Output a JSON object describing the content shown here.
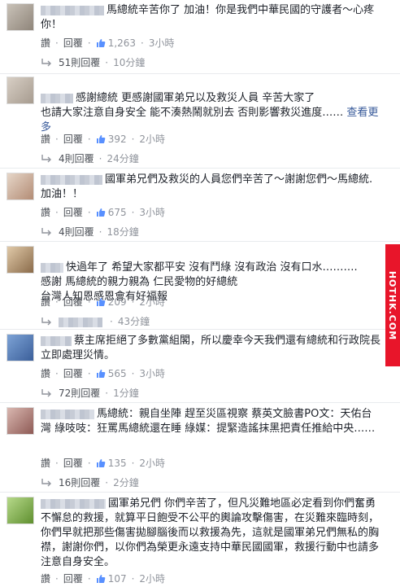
{
  "labels": {
    "like": "讚",
    "reply": "回覆"
  },
  "watermark": "HOTHK.COM",
  "comments": [
    {
      "text": "馬總統辛苦你了 加油！你是我們中華民國的守護者～心疼你！",
      "see_more": "",
      "likes": "1,263",
      "time": "3小時",
      "reply_count": "51則回覆",
      "reply_time": "10分鐘"
    },
    {
      "text": "感謝總統 更感謝國軍弟兄以及救災人員 辛苦大家了\n也請大家注意自身安全 能不湊熱鬧就別去 否則影響救災進度……",
      "see_more": "查看更多",
      "likes": "392",
      "time": "2小時",
      "reply_count": "4則回覆",
      "reply_time": "24分鐘"
    },
    {
      "text": "國軍弟兄們及救災的人員您們辛苦了～謝謝您們～馬總統.加油！！",
      "see_more": "",
      "likes": "675",
      "time": "3小時",
      "reply_count": "4則回覆",
      "reply_time": "18分鐘"
    },
    {
      "text": "快過年了 希望大家都平安 沒有鬥綠 沒有政治 沒有口水……….\n感謝 馬總統的親力親為 仁民愛物的好總統\n台灣人知恩感恩會有好福報",
      "see_more": "",
      "likes": "209",
      "time": "2小時",
      "reply_count": "",
      "reply_time": "43分鐘"
    },
    {
      "text": "蔡主席拒絕了多數黨組閣，所以慶幸今天我們還有總統和行政院長立即處理災情。",
      "see_more": "",
      "likes": "565",
      "time": "3小時",
      "reply_count": "72則回覆",
      "reply_time": "1分鐘"
    },
    {
      "text": "馬總統：親自坐陣 趕至災區視察 蔡英文臉書PO文：天佑台灣 綠吱吱：狂罵馬總統還在睡 綠媒：提緊造謠抹黑把責任推給中央……",
      "see_more": "",
      "likes": "135",
      "time": "2小時",
      "reply_count": "16則回覆",
      "reply_time": "2分鐘"
    },
    {
      "text": "國軍弟兄們 你們辛苦了，但凡災難地區必定看到你們奮勇不懈怠的救援，就算平日飽受不公平的輿論攻擊傷害，在災難來臨時刻，你們早就把那些傷害拋腳腦後而以救援為先，這就是國軍弟兄們無私的胸襟，謝謝你們，以你們為榮更永遠支持中華民國國軍，救援行動中也請多注意自身安全。",
      "see_more": "",
      "likes": "107",
      "time": "2小時",
      "reply_count": "",
      "reply_time": ""
    }
  ]
}
